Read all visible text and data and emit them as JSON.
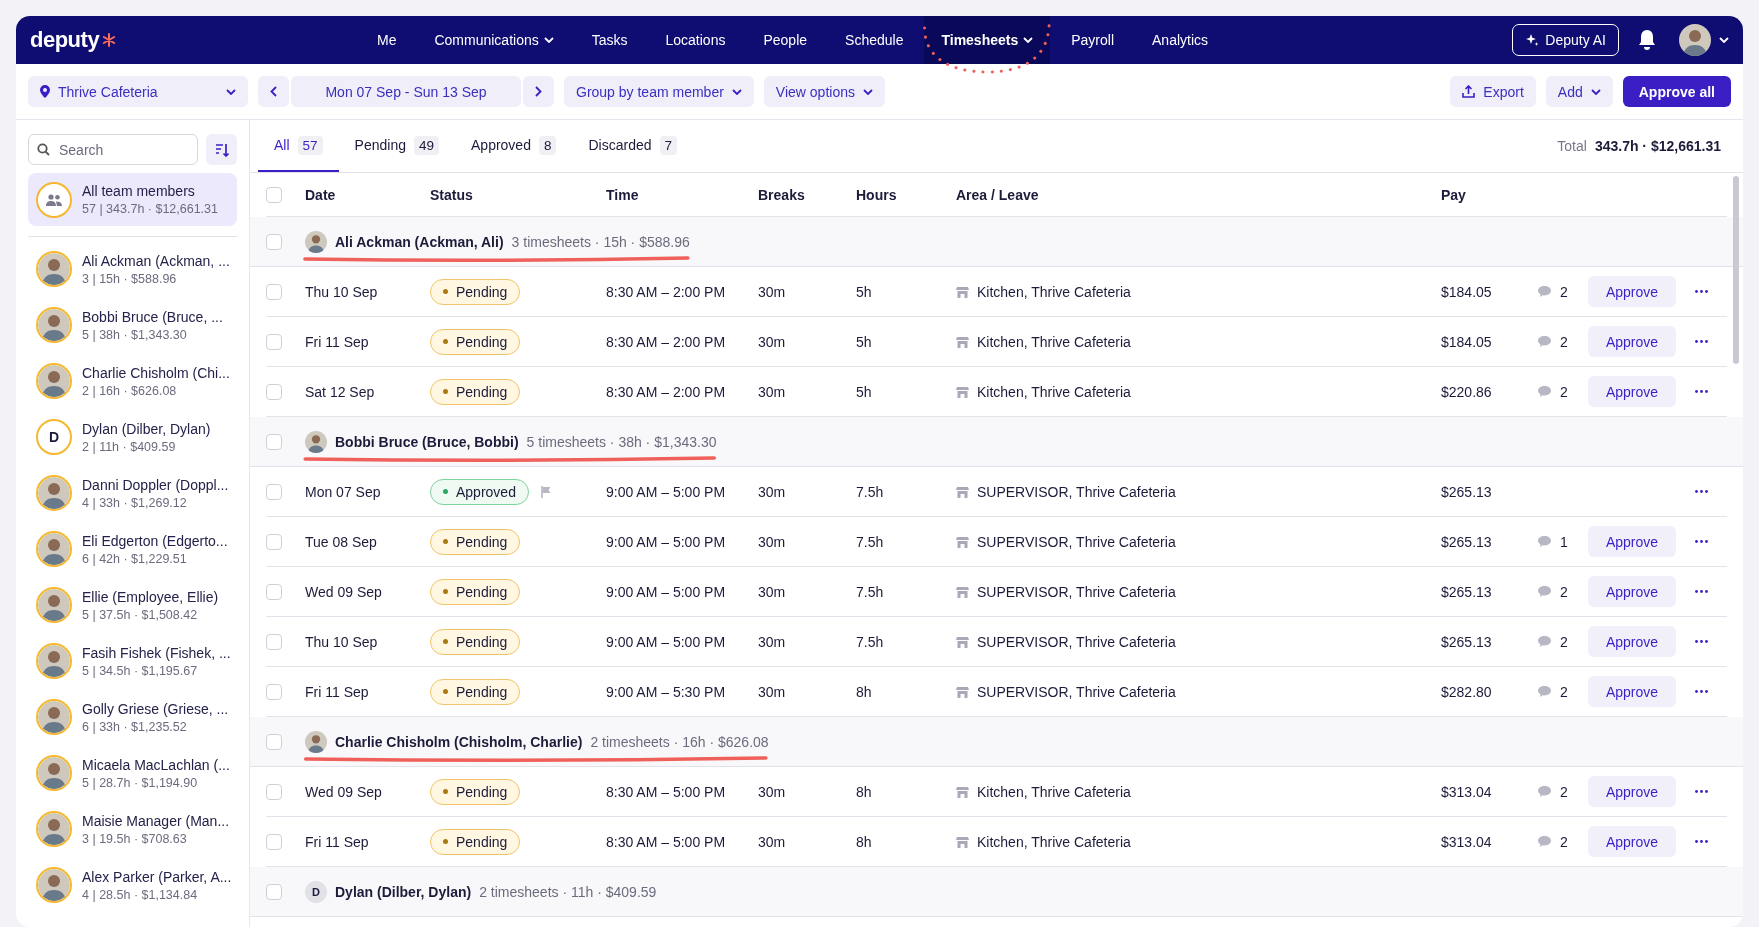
{
  "nav": {
    "logo": "deputy",
    "items": [
      {
        "label": "Me",
        "selected": false,
        "caret": false,
        "circled": false
      },
      {
        "label": "Communications",
        "selected": false,
        "caret": true,
        "circled": false
      },
      {
        "label": "Tasks",
        "selected": false,
        "caret": false,
        "circled": false
      },
      {
        "label": "Locations",
        "selected": false,
        "caret": false,
        "circled": false
      },
      {
        "label": "People",
        "selected": false,
        "caret": false,
        "circled": false
      },
      {
        "label": "Schedule",
        "selected": false,
        "caret": false,
        "circled": false
      },
      {
        "label": "Timesheets",
        "selected": true,
        "caret": true,
        "circled": true
      },
      {
        "label": "Payroll",
        "selected": false,
        "caret": false,
        "circled": false
      },
      {
        "label": "Analytics",
        "selected": false,
        "caret": false,
        "circled": false
      }
    ],
    "ai_button": "Deputy AI"
  },
  "toolbar": {
    "location": "Thrive Cafeteria",
    "date_range": "Mon 07 Sep - Sun 13 Sep",
    "group_by": "Group by team member",
    "view_options": "View options",
    "export": "Export",
    "add": "Add",
    "approve_all": "Approve all"
  },
  "sidebar": {
    "search_placeholder": "Search",
    "all": {
      "name": "All team members",
      "summary": "57 | 343.7h · $12,661.31",
      "selected": true
    },
    "members": [
      {
        "name": "Ali Ackman (Ackman, ...",
        "summary": "3 | 15h · $588.96",
        "kind": "photo",
        "selected": false
      },
      {
        "name": "Bobbi Bruce (Bruce, ...",
        "summary": "5 | 38h · $1,343.30",
        "kind": "photo",
        "selected": false
      },
      {
        "name": "Charlie Chisholm (Chi...",
        "summary": "2 | 16h · $626.08",
        "kind": "photo",
        "selected": false
      },
      {
        "name": "Dylan (Dilber, Dylan)",
        "summary": "2 | 11h · $409.59",
        "kind": "initial",
        "initial": "D",
        "selected": false
      },
      {
        "name": "Danni Doppler (Doppl...",
        "summary": "4 | 33h · $1,269.12",
        "kind": "photo",
        "selected": false
      },
      {
        "name": "Eli Edgerton (Edgerto...",
        "summary": "6 | 42h · $1,229.51",
        "kind": "photo",
        "selected": false
      },
      {
        "name": "Ellie (Employee, Ellie)",
        "summary": "5 | 37.5h · $1,508.42",
        "kind": "photo",
        "selected": false
      },
      {
        "name": "Fasih Fishek (Fishek, ...",
        "summary": "5 | 34.5h · $1,195.67",
        "kind": "photo",
        "selected": false
      },
      {
        "name": "Golly Griese (Griese, ...",
        "summary": "6 | 33h · $1,235.52",
        "kind": "photo",
        "selected": false
      },
      {
        "name": "Micaela MacLachlan (...",
        "summary": "5 | 28.7h · $1,194.90",
        "kind": "photo",
        "selected": false
      },
      {
        "name": "Maisie Manager (Man...",
        "summary": "3 | 19.5h · $708.63",
        "kind": "photo",
        "selected": false
      },
      {
        "name": "Alex Parker (Parker, A...",
        "summary": "4 | 28.5h · $1,134.84",
        "kind": "photo",
        "selected": false
      }
    ]
  },
  "tabs": [
    {
      "label": "All",
      "count": "57",
      "selected": true
    },
    {
      "label": "Pending",
      "count": "49",
      "selected": false
    },
    {
      "label": "Approved",
      "count": "8",
      "selected": false
    },
    {
      "label": "Discarded",
      "count": "7",
      "selected": false
    }
  ],
  "total": {
    "label": "Total",
    "value": "343.7h · $12,661.31"
  },
  "table": {
    "all_checked": false,
    "columns": [
      "Date",
      "Status",
      "Time",
      "Breaks",
      "Hours",
      "Area / Leave",
      "Pay"
    ],
    "groups": [
      {
        "name": "Ali Ackman (Ackman, Ali)",
        "summary": "3 timesheets · 15h · $588.96",
        "kind": "photo",
        "underlined": true,
        "checked": false,
        "rows": [
          {
            "date": "Thu 10 Sep",
            "status": "Pending",
            "kind": "pending",
            "flagged": false,
            "checked": false,
            "time": "8:30 AM – 2:00 PM",
            "breaks": "30m",
            "hours": "5h",
            "area": "Kitchen, Thrive Cafeteria",
            "pay": "$184.05",
            "comments": "2",
            "action": "Approve"
          },
          {
            "date": "Fri 11 Sep",
            "status": "Pending",
            "kind": "pending",
            "flagged": false,
            "checked": false,
            "time": "8:30 AM – 2:00 PM",
            "breaks": "30m",
            "hours": "5h",
            "area": "Kitchen, Thrive Cafeteria",
            "pay": "$184.05",
            "comments": "2",
            "action": "Approve"
          },
          {
            "date": "Sat 12 Sep",
            "status": "Pending",
            "kind": "pending",
            "flagged": false,
            "checked": false,
            "time": "8:30 AM – 2:00 PM",
            "breaks": "30m",
            "hours": "5h",
            "area": "Kitchen, Thrive Cafeteria",
            "pay": "$220.86",
            "comments": "2",
            "action": "Approve"
          }
        ]
      },
      {
        "name": "Bobbi Bruce (Bruce, Bobbi)",
        "summary": "5 timesheets · 38h · $1,343.30",
        "kind": "photo",
        "underlined": true,
        "checked": false,
        "rows": [
          {
            "date": "Mon 07 Sep",
            "status": "Approved",
            "kind": "approved",
            "flagged": true,
            "checked": false,
            "time": "9:00 AM – 5:00 PM",
            "breaks": "30m",
            "hours": "7.5h",
            "area": "SUPERVISOR, Thrive Cafeteria",
            "pay": "$265.13"
          },
          {
            "date": "Tue 08 Sep",
            "status": "Pending",
            "kind": "pending",
            "flagged": false,
            "checked": false,
            "time": "9:00 AM – 5:00 PM",
            "breaks": "30m",
            "hours": "7.5h",
            "area": "SUPERVISOR, Thrive Cafeteria",
            "pay": "$265.13",
            "comments": "1",
            "action": "Approve"
          },
          {
            "date": "Wed 09 Sep",
            "status": "Pending",
            "kind": "pending",
            "flagged": false,
            "checked": false,
            "time": "9:00 AM – 5:00 PM",
            "breaks": "30m",
            "hours": "7.5h",
            "area": "SUPERVISOR, Thrive Cafeteria",
            "pay": "$265.13",
            "comments": "2",
            "action": "Approve"
          },
          {
            "date": "Thu 10 Sep",
            "status": "Pending",
            "kind": "pending",
            "flagged": false,
            "checked": false,
            "time": "9:00 AM – 5:00 PM",
            "breaks": "30m",
            "hours": "7.5h",
            "area": "SUPERVISOR, Thrive Cafeteria",
            "pay": "$265.13",
            "comments": "2",
            "action": "Approve"
          },
          {
            "date": "Fri 11 Sep",
            "status": "Pending",
            "kind": "pending",
            "flagged": false,
            "checked": false,
            "time": "9:00 AM – 5:30 PM",
            "breaks": "30m",
            "hours": "8h",
            "area": "SUPERVISOR, Thrive Cafeteria",
            "pay": "$282.80",
            "comments": "2",
            "action": "Approve"
          }
        ]
      },
      {
        "name": "Charlie Chisholm (Chisholm, Charlie)",
        "summary": "2 timesheets · 16h · $626.08",
        "kind": "photo",
        "underlined": true,
        "checked": false,
        "rows": [
          {
            "date": "Wed 09 Sep",
            "status": "Pending",
            "kind": "pending",
            "flagged": false,
            "checked": false,
            "time": "8:30 AM – 5:00 PM",
            "breaks": "30m",
            "hours": "8h",
            "area": "Kitchen, Thrive Cafeteria",
            "pay": "$313.04",
            "comments": "2",
            "action": "Approve"
          },
          {
            "date": "Fri 11 Sep",
            "status": "Pending",
            "kind": "pending",
            "flagged": false,
            "checked": false,
            "time": "8:30 AM – 5:00 PM",
            "breaks": "30m",
            "hours": "8h",
            "area": "Kitchen, Thrive Cafeteria",
            "pay": "$313.04",
            "comments": "2",
            "action": "Approve"
          }
        ]
      },
      {
        "name": "Dylan (Dilber, Dylan)",
        "summary": "2 timesheets · 11h · $409.59",
        "kind": "initial",
        "initial": "D",
        "underlined": false,
        "checked": false
      }
    ]
  }
}
